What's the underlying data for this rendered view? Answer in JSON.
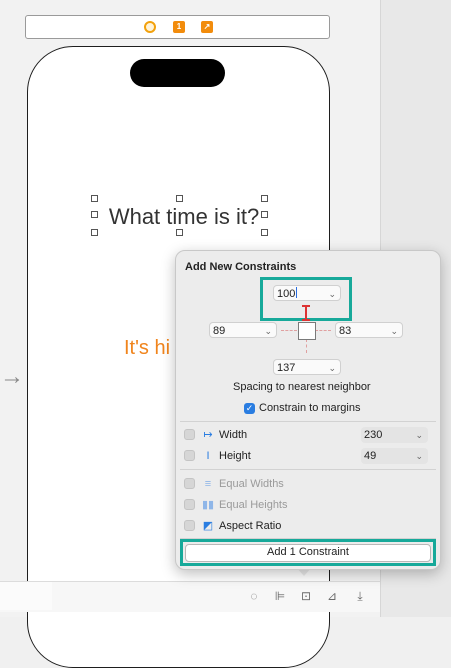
{
  "canvas": {
    "title_label": "What time is it?",
    "result_label": "It's hi",
    "entry_arrow": "→"
  },
  "scene_dock": {
    "first_responder_glyph": "1",
    "exit_glyph": "↗"
  },
  "popover": {
    "title": "Add New Constraints",
    "spacing": {
      "top": "100",
      "left": "89",
      "right": "83",
      "bottom": "137"
    },
    "spacing_caption": "Spacing to nearest neighbor",
    "constrain_to_margins": {
      "label": "Constrain to margins",
      "checked": true
    },
    "rows": [
      {
        "label": "Width",
        "icon": "width-icon",
        "glyph": "↦",
        "value": "230",
        "enabled": true
      },
      {
        "label": "Height",
        "icon": "height-icon",
        "glyph": "I",
        "value": "49",
        "enabled": true
      },
      {
        "label": "Equal Widths",
        "icon": "equal-widths-icon",
        "glyph": "≡",
        "enabled": false
      },
      {
        "label": "Equal Heights",
        "icon": "equal-heights-icon",
        "glyph": "▮▮",
        "enabled": false
      },
      {
        "label": "Aspect Ratio",
        "icon": "aspect-ratio-icon",
        "glyph": "◩",
        "enabled": true
      }
    ],
    "add_button": "Add 1 Constraint"
  },
  "toolbar": {
    "update_frames_icon": "update-frames-icon",
    "align_icon": "align-icon",
    "add_constraints_icon": "add-constraints-icon",
    "resolve_issues_icon": "resolve-issues-icon",
    "embed_in_icon": "embed-in-icon"
  },
  "colors": {
    "accent": "#2a7de1",
    "highlight": "#17a99a",
    "result_text": "#f0841c"
  }
}
